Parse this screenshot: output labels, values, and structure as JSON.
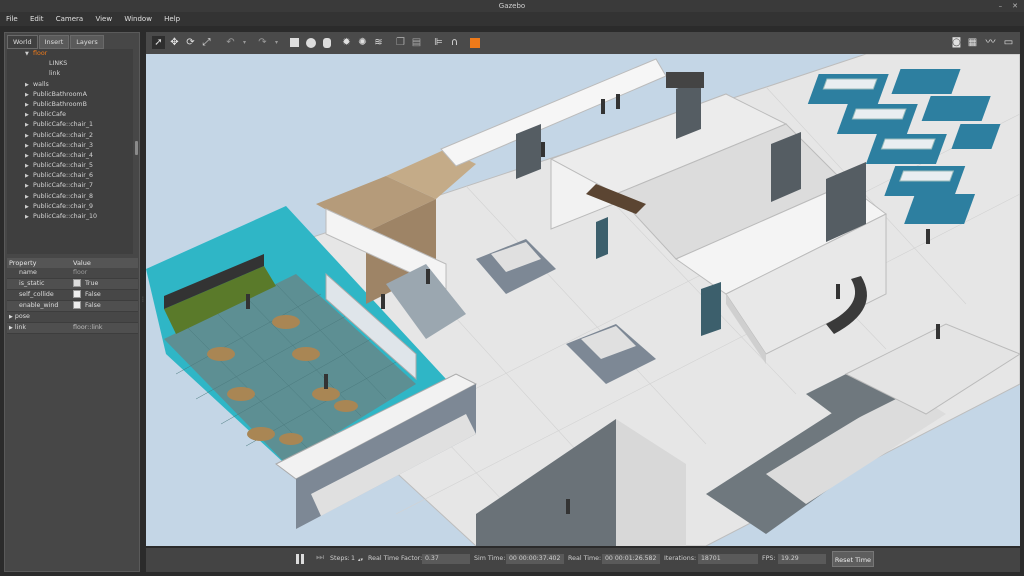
{
  "window": {
    "title": "Gazebo"
  },
  "menu": [
    "File",
    "Edit",
    "Camera",
    "View",
    "Window",
    "Help"
  ],
  "left_panel": {
    "tabs": [
      "World",
      "Insert",
      "Layers"
    ],
    "tree": [
      {
        "label": "floor",
        "selected": true,
        "indent": 1,
        "arrow": "down"
      },
      {
        "label": "LINKS",
        "indent": 2,
        "arrow": ""
      },
      {
        "label": "link",
        "indent": 2,
        "arrow": ""
      },
      {
        "label": "walls",
        "indent": 1,
        "arrow": "right"
      },
      {
        "label": "PublicBathroomA",
        "indent": 1,
        "arrow": "right"
      },
      {
        "label": "PublicBathroomB",
        "indent": 1,
        "arrow": "right"
      },
      {
        "label": "PublicCafe",
        "indent": 1,
        "arrow": "right"
      },
      {
        "label": "PublicCafe::chair_1",
        "indent": 1,
        "arrow": "right"
      },
      {
        "label": "PublicCafe::chair_2",
        "indent": 1,
        "arrow": "right"
      },
      {
        "label": "PublicCafe::chair_3",
        "indent": 1,
        "arrow": "right"
      },
      {
        "label": "PublicCafe::chair_4",
        "indent": 1,
        "arrow": "right"
      },
      {
        "label": "PublicCafe::chair_5",
        "indent": 1,
        "arrow": "right"
      },
      {
        "label": "PublicCafe::chair_6",
        "indent": 1,
        "arrow": "right"
      },
      {
        "label": "PublicCafe::chair_7",
        "indent": 1,
        "arrow": "right"
      },
      {
        "label": "PublicCafe::chair_8",
        "indent": 1,
        "arrow": "right"
      },
      {
        "label": "PublicCafe::chair_9",
        "indent": 1,
        "arrow": "right"
      },
      {
        "label": "PublicCafe::chair_10",
        "indent": 1,
        "arrow": "right"
      }
    ],
    "properties": {
      "header": {
        "property": "Property",
        "value": "Value"
      },
      "rows": [
        {
          "name": "name",
          "value": "floor",
          "type": "text"
        },
        {
          "name": "is_static",
          "value": "True",
          "type": "check",
          "checked": true
        },
        {
          "name": "self_collide",
          "value": "False",
          "type": "check",
          "checked": false
        },
        {
          "name": "enable_wind",
          "value": "False",
          "type": "check",
          "checked": false
        },
        {
          "name": "pose",
          "value": "",
          "type": "group"
        },
        {
          "name": "link",
          "value": "floor::link",
          "type": "group"
        }
      ]
    }
  },
  "toolbar": {
    "icons": [
      "select-mode-icon",
      "translate-mode-icon",
      "rotate-mode-icon",
      "scale-mode-icon",
      "undo-icon",
      "undo-dropdown-icon",
      "redo-icon",
      "redo-dropdown-icon",
      "box-shape-icon",
      "sphere-shape-icon",
      "cylinder-shape-icon",
      "point-light-icon",
      "spot-light-icon",
      "directional-light-icon",
      "copy-icon",
      "paste-icon",
      "align-icon",
      "snap-icon",
      "view-angle-icon",
      "screenshot-icon",
      "log-icon",
      "plot-icon",
      "video-record-icon"
    ]
  },
  "bottom_bar": {
    "steps_label": "Steps:",
    "steps_value": "1",
    "rtf_label": "Real Time Factor:",
    "rtf_value": "0.37",
    "sim_time_label": "Sim Time:",
    "sim_time_value": "00 00:00:37.402",
    "real_time_label": "Real Time:",
    "real_time_value": "00 00:01:26.582",
    "iterations_label": "Iterations:",
    "iterations_value": "18701",
    "fps_label": "FPS:",
    "fps_value": "19.29",
    "reset_label": "Reset Time"
  },
  "colors": {
    "accent_orange": "#ee7a1a",
    "floor_teal": "#2fb6c6",
    "cubicle_blue": "#2d7fa0",
    "sky": "#c4d6e6"
  }
}
